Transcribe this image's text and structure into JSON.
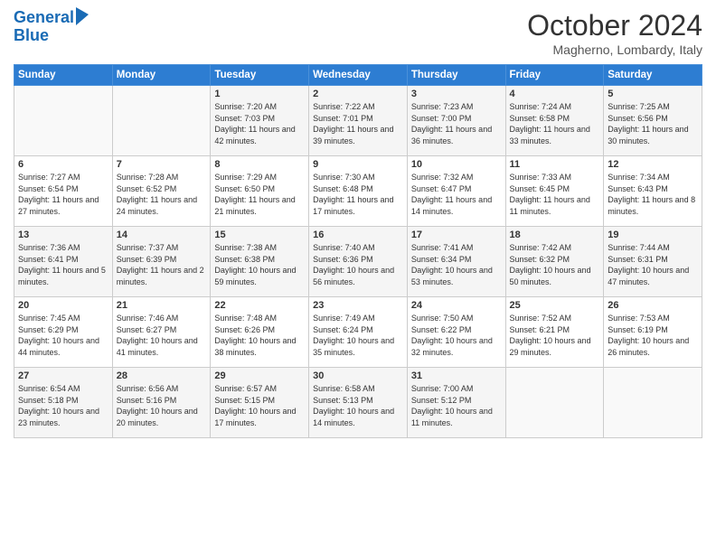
{
  "header": {
    "logo_line1": "General",
    "logo_line2": "Blue",
    "month_year": "October 2024",
    "location": "Magherno, Lombardy, Italy"
  },
  "days_of_week": [
    "Sunday",
    "Monday",
    "Tuesday",
    "Wednesday",
    "Thursday",
    "Friday",
    "Saturday"
  ],
  "weeks": [
    [
      {
        "day": "",
        "info": ""
      },
      {
        "day": "",
        "info": ""
      },
      {
        "day": "1",
        "info": "Sunrise: 7:20 AM\nSunset: 7:03 PM\nDaylight: 11 hours and 42 minutes."
      },
      {
        "day": "2",
        "info": "Sunrise: 7:22 AM\nSunset: 7:01 PM\nDaylight: 11 hours and 39 minutes."
      },
      {
        "day": "3",
        "info": "Sunrise: 7:23 AM\nSunset: 7:00 PM\nDaylight: 11 hours and 36 minutes."
      },
      {
        "day": "4",
        "info": "Sunrise: 7:24 AM\nSunset: 6:58 PM\nDaylight: 11 hours and 33 minutes."
      },
      {
        "day": "5",
        "info": "Sunrise: 7:25 AM\nSunset: 6:56 PM\nDaylight: 11 hours and 30 minutes."
      }
    ],
    [
      {
        "day": "6",
        "info": "Sunrise: 7:27 AM\nSunset: 6:54 PM\nDaylight: 11 hours and 27 minutes."
      },
      {
        "day": "7",
        "info": "Sunrise: 7:28 AM\nSunset: 6:52 PM\nDaylight: 11 hours and 24 minutes."
      },
      {
        "day": "8",
        "info": "Sunrise: 7:29 AM\nSunset: 6:50 PM\nDaylight: 11 hours and 21 minutes."
      },
      {
        "day": "9",
        "info": "Sunrise: 7:30 AM\nSunset: 6:48 PM\nDaylight: 11 hours and 17 minutes."
      },
      {
        "day": "10",
        "info": "Sunrise: 7:32 AM\nSunset: 6:47 PM\nDaylight: 11 hours and 14 minutes."
      },
      {
        "day": "11",
        "info": "Sunrise: 7:33 AM\nSunset: 6:45 PM\nDaylight: 11 hours and 11 minutes."
      },
      {
        "day": "12",
        "info": "Sunrise: 7:34 AM\nSunset: 6:43 PM\nDaylight: 11 hours and 8 minutes."
      }
    ],
    [
      {
        "day": "13",
        "info": "Sunrise: 7:36 AM\nSunset: 6:41 PM\nDaylight: 11 hours and 5 minutes."
      },
      {
        "day": "14",
        "info": "Sunrise: 7:37 AM\nSunset: 6:39 PM\nDaylight: 11 hours and 2 minutes."
      },
      {
        "day": "15",
        "info": "Sunrise: 7:38 AM\nSunset: 6:38 PM\nDaylight: 10 hours and 59 minutes."
      },
      {
        "day": "16",
        "info": "Sunrise: 7:40 AM\nSunset: 6:36 PM\nDaylight: 10 hours and 56 minutes."
      },
      {
        "day": "17",
        "info": "Sunrise: 7:41 AM\nSunset: 6:34 PM\nDaylight: 10 hours and 53 minutes."
      },
      {
        "day": "18",
        "info": "Sunrise: 7:42 AM\nSunset: 6:32 PM\nDaylight: 10 hours and 50 minutes."
      },
      {
        "day": "19",
        "info": "Sunrise: 7:44 AM\nSunset: 6:31 PM\nDaylight: 10 hours and 47 minutes."
      }
    ],
    [
      {
        "day": "20",
        "info": "Sunrise: 7:45 AM\nSunset: 6:29 PM\nDaylight: 10 hours and 44 minutes."
      },
      {
        "day": "21",
        "info": "Sunrise: 7:46 AM\nSunset: 6:27 PM\nDaylight: 10 hours and 41 minutes."
      },
      {
        "day": "22",
        "info": "Sunrise: 7:48 AM\nSunset: 6:26 PM\nDaylight: 10 hours and 38 minutes."
      },
      {
        "day": "23",
        "info": "Sunrise: 7:49 AM\nSunset: 6:24 PM\nDaylight: 10 hours and 35 minutes."
      },
      {
        "day": "24",
        "info": "Sunrise: 7:50 AM\nSunset: 6:22 PM\nDaylight: 10 hours and 32 minutes."
      },
      {
        "day": "25",
        "info": "Sunrise: 7:52 AM\nSunset: 6:21 PM\nDaylight: 10 hours and 29 minutes."
      },
      {
        "day": "26",
        "info": "Sunrise: 7:53 AM\nSunset: 6:19 PM\nDaylight: 10 hours and 26 minutes."
      }
    ],
    [
      {
        "day": "27",
        "info": "Sunrise: 6:54 AM\nSunset: 5:18 PM\nDaylight: 10 hours and 23 minutes."
      },
      {
        "day": "28",
        "info": "Sunrise: 6:56 AM\nSunset: 5:16 PM\nDaylight: 10 hours and 20 minutes."
      },
      {
        "day": "29",
        "info": "Sunrise: 6:57 AM\nSunset: 5:15 PM\nDaylight: 10 hours and 17 minutes."
      },
      {
        "day": "30",
        "info": "Sunrise: 6:58 AM\nSunset: 5:13 PM\nDaylight: 10 hours and 14 minutes."
      },
      {
        "day": "31",
        "info": "Sunrise: 7:00 AM\nSunset: 5:12 PM\nDaylight: 10 hours and 11 minutes."
      },
      {
        "day": "",
        "info": ""
      },
      {
        "day": "",
        "info": ""
      }
    ]
  ]
}
